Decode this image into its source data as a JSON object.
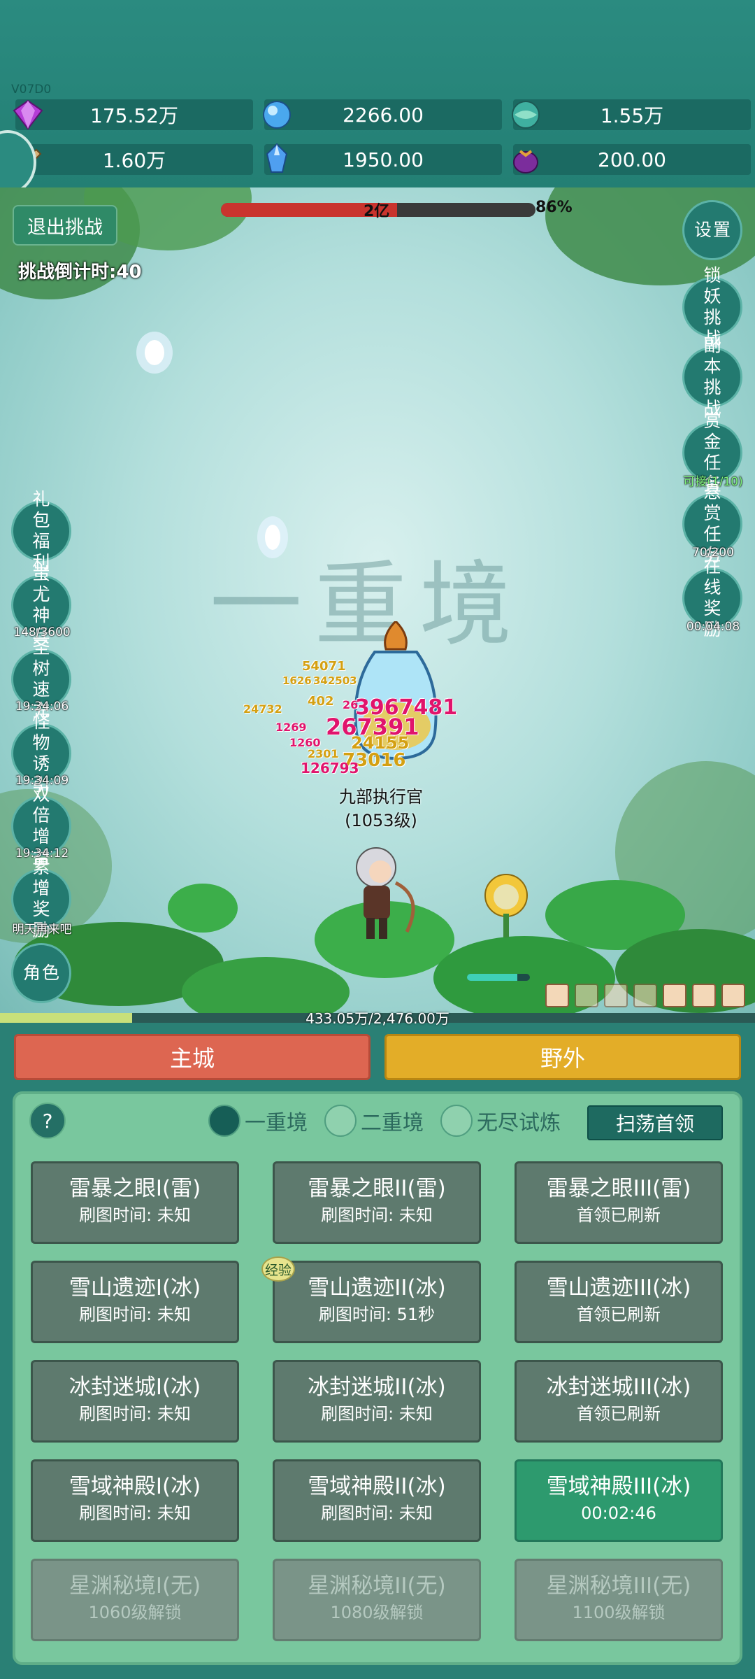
{
  "version": "V07D0",
  "resources": [
    {
      "icon": "purple-gem-icon",
      "value": "175.52万"
    },
    {
      "icon": "blue-orb-icon",
      "value": "2266.00"
    },
    {
      "icon": "teal-globe-icon",
      "value": "1.55万"
    },
    {
      "icon": "horn-icon",
      "value": "1.60万"
    },
    {
      "icon": "blue-crystal-icon",
      "value": "1950.00"
    },
    {
      "icon": "purple-pouch-icon",
      "value": "200.00"
    }
  ],
  "boss": {
    "hp_label": "2亿",
    "hp_percent_label": "86%",
    "hp_fraction": 0.56,
    "name": "九部执行官",
    "level": "(1053级)"
  },
  "battle": {
    "exit_label": "退出挑战",
    "countdown": "挑战倒计时:40",
    "realm_watermark": "一重境",
    "damage_numbers": [
      "54071",
      "1626",
      "342503",
      "402",
      "26",
      "3967481",
      "267391",
      "1269",
      "24155",
      "1260",
      "2301",
      "73016",
      "126793",
      "24732"
    ]
  },
  "right_buttons": [
    {
      "label": "设置",
      "sub": ""
    },
    {
      "label": "锁妖挑战",
      "sub": ""
    },
    {
      "label": "副本挑战",
      "sub": ""
    },
    {
      "label": "赏金任务",
      "sub": "可接(1/10)"
    },
    {
      "label": "悬赏任务",
      "sub": "70/200"
    },
    {
      "label": "在线奖励",
      "sub": "00:04:08"
    }
  ],
  "left_buttons": [
    {
      "label": "礼包福利",
      "sub": ""
    },
    {
      "label": "蚩尤神兵",
      "sub": "148/3600"
    },
    {
      "label": "圣树速充",
      "sub": "19:34:06"
    },
    {
      "label": "怪物诱引",
      "sub": "19:34:09"
    },
    {
      "label": "双倍增益",
      "sub": "19:34:12"
    },
    {
      "label": "累增奖励",
      "sub": "明天再来吧"
    },
    {
      "label": "角色",
      "sub": ""
    }
  ],
  "exp": {
    "text": "433.05万/2,476.00万",
    "fraction": 0.175
  },
  "tabs": {
    "main_city": "主城",
    "wild": "野外"
  },
  "stage_panel": {
    "help": "?",
    "realms": [
      {
        "label": "一重境",
        "selected": true
      },
      {
        "label": "二重境",
        "selected": false
      },
      {
        "label": "无尽试炼",
        "selected": false
      }
    ],
    "sweep_label": "扫荡首领",
    "exp_badge": "经验",
    "stages": [
      {
        "title": "雷暴之眼I(雷)",
        "status": "刷图时间: 未知",
        "state": "normal"
      },
      {
        "title": "雷暴之眼II(雷)",
        "status": "刷图时间: 未知",
        "state": "normal"
      },
      {
        "title": "雷暴之眼III(雷)",
        "status": "首领已刷新",
        "state": "normal"
      },
      {
        "title": "雪山遗迹I(冰)",
        "status": "刷图时间: 未知",
        "state": "normal"
      },
      {
        "title": "雪山遗迹II(冰)",
        "status": "刷图时间: 51秒",
        "state": "normal"
      },
      {
        "title": "雪山遗迹III(冰)",
        "status": "首领已刷新",
        "state": "normal"
      },
      {
        "title": "冰封迷城I(冰)",
        "status": "刷图时间: 未知",
        "state": "normal"
      },
      {
        "title": "冰封迷城II(冰)",
        "status": "刷图时间: 未知",
        "state": "normal"
      },
      {
        "title": "冰封迷城III(冰)",
        "status": "首领已刷新",
        "state": "normal"
      },
      {
        "title": "雪域神殿I(冰)",
        "status": "刷图时间: 未知",
        "state": "normal"
      },
      {
        "title": "雪域神殿II(冰)",
        "status": "刷图时间: 未知",
        "state": "normal"
      },
      {
        "title": "雪域神殿III(冰)",
        "status": "00:02:46",
        "state": "active"
      },
      {
        "title": "星渊秘境I(无)",
        "status": "1060级解锁",
        "state": "locked"
      },
      {
        "title": "星渊秘境II(无)",
        "status": "1080级解锁",
        "state": "locked"
      },
      {
        "title": "星渊秘境III(无)",
        "status": "1100级解锁",
        "state": "locked"
      }
    ]
  },
  "colors": {
    "main_city_tab": "#dd6651",
    "wild_tab": "#e3ad28",
    "panel": "#79c79e",
    "hp_fill": "#c9342e"
  }
}
